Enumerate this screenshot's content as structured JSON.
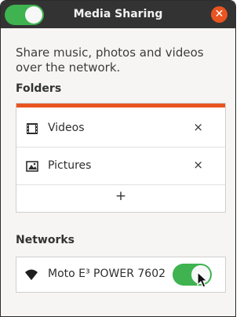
{
  "window": {
    "title": "Media Sharing",
    "master_switch": "on",
    "close_icon": "close-icon"
  },
  "description": "Share music, photos and videos over the network.",
  "folders": {
    "heading": "Folders",
    "items": [
      {
        "label": "Videos",
        "icon": "film-icon",
        "remove": "×"
      },
      {
        "label": "Pictures",
        "icon": "image-icon",
        "remove": "×"
      }
    ],
    "add_label": "+"
  },
  "networks": {
    "heading": "Networks",
    "items": [
      {
        "name": "Moto E³ POWER 7602",
        "icon": "wifi-icon",
        "state": "on"
      }
    ]
  },
  "colors": {
    "accent": "#e95420",
    "switch_on": "#3eb34f",
    "titlebar": "#333333"
  }
}
